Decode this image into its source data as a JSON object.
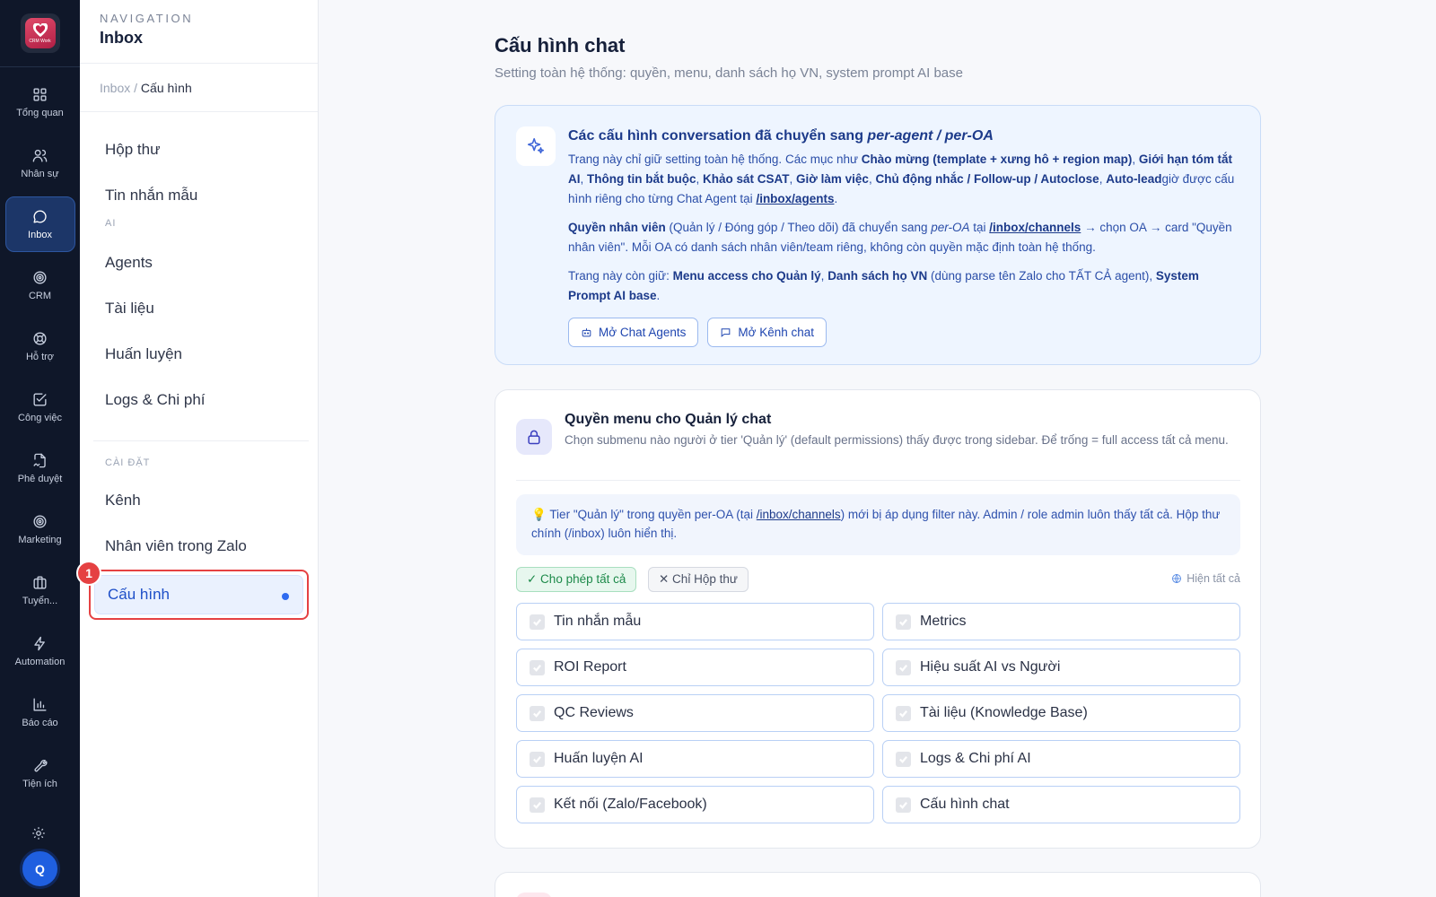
{
  "rail": {
    "logo_text": "CRM Work",
    "items": [
      {
        "label": "Tổng quan",
        "icon": "grid-icon"
      },
      {
        "label": "Nhân sự",
        "icon": "users-icon"
      },
      {
        "label": "Inbox",
        "icon": "chat-bubble-icon",
        "active": true
      },
      {
        "label": "CRM",
        "icon": "target-icon"
      },
      {
        "label": "Hỗ trợ",
        "icon": "lifebuoy-icon"
      },
      {
        "label": "Công việc",
        "icon": "checkbox-icon"
      },
      {
        "label": "Phê duyệt",
        "icon": "file-signature-icon"
      },
      {
        "label": "Marketing",
        "icon": "target-icon"
      },
      {
        "label": "Tuyển...",
        "icon": "briefcase-icon"
      },
      {
        "label": "Automation",
        "icon": "lightning-icon"
      },
      {
        "label": "Báo cáo",
        "icon": "bar-chart-icon"
      },
      {
        "label": "Tiện ích",
        "icon": "wrench-icon"
      }
    ],
    "avatar": "Q"
  },
  "nav": {
    "kicker": "NAVIGATION",
    "title": "Inbox",
    "breadcrumb_root": "Inbox",
    "breadcrumb_sep": "/",
    "breadcrumb_current": "Cấu hình",
    "group1": [
      "Hộp thư",
      "Tin nhắn mẫu"
    ],
    "section_ai": "AI",
    "group_ai": [
      "Agents",
      "Tài liệu",
      "Huấn luyện",
      "Logs & Chi phí"
    ],
    "section_settings": "CÀI ĐẶT",
    "group_settings": [
      "Kênh",
      "Nhân viên trong Zalo"
    ],
    "active_item": "Cấu hình",
    "step_badge": "1"
  },
  "page": {
    "title": "Cấu hình chat",
    "subtitle": "Setting toàn hệ thống: quyền, menu, danh sách họ VN, system prompt AI base"
  },
  "notice": {
    "title_prefix": "Các cấu hình conversation đã chuyển sang ",
    "title_em": "per-agent / per-OA",
    "p1_a": "Trang này chỉ giữ setting toàn hệ thống. Các mục như ",
    "p1_b1": "Chào mừng (template + xưng hô + region map)",
    "p1_c": ", ",
    "p1_b2": "Giới hạn tóm tắt AI",
    "p1_b3": "Thông tin bắt buộc",
    "p1_b4": "Khảo sát CSAT",
    "p1_b5": "Giờ làm việc",
    "p1_b6": "Chủ động nhắc / Follow-up / Autoclose",
    "p1_b7": "Auto-lead",
    "p1_d": "giờ được cấu hình riêng cho từng Chat Agent tại ",
    "p1_link": "/inbox/agents",
    "p1_end": ".",
    "p2_b": "Quyền nhân viên",
    "p2_a": " (Quản lý / Đóng góp / Theo dõi) đã chuyển sang ",
    "p2_em": "per-OA",
    "p2_c": " tại ",
    "p2_link": "/inbox/channels",
    "p2_d": " → chọn OA → card \"Quyền nhân viên\". Mỗi OA có danh sách nhân viên/team riêng, không còn quyền mặc định toàn hệ thống.",
    "p3_a": "Trang này còn giữ: ",
    "p3_b1": "Menu access cho Quản lý",
    "p3_c": ", ",
    "p3_b2": "Danh sách họ VN",
    "p3_d": " (dùng parse tên Zalo cho TẤT CẢ agent), ",
    "p3_b3": "System Prompt AI base",
    "p3_end": ".",
    "btn_agents": "Mở Chat Agents",
    "btn_channels": "Mở Kênh chat"
  },
  "menu_card": {
    "title": "Quyền menu cho Quản lý chat",
    "desc": "Chọn submenu nào người ở tier 'Quản lý' (default permissions) thấy được trong sidebar. Để trống = full access tất cả menu.",
    "tip_a": "💡 Tier \"Quản lý\" trong quyền per-OA (tại ",
    "tip_link": "/inbox/channels",
    "tip_b": ") mới bị áp dụng filter này. Admin / role admin luôn thấy tất cả. Hộp thư chính (/inbox) luôn hiển thị.",
    "chip_allow": "✓ Cho phép tất cả",
    "chip_inbox": "✕ Chỉ Hộp thư",
    "show_all": "Hiện tất cả",
    "options": [
      "Tin nhắn mẫu",
      "Metrics",
      "ROI Report",
      "Hiệu suất AI vs Người",
      "QC Reviews",
      "Tài liệu (Knowledge Base)",
      "Huấn luyện AI",
      "Logs & Chi phí AI",
      "Kết nối (Zalo/Facebook)",
      "Cấu hình chat"
    ]
  },
  "colors": {
    "rail_bg": "#0f1729",
    "accent": "#2f6bf0",
    "highlight": "#e54142"
  }
}
